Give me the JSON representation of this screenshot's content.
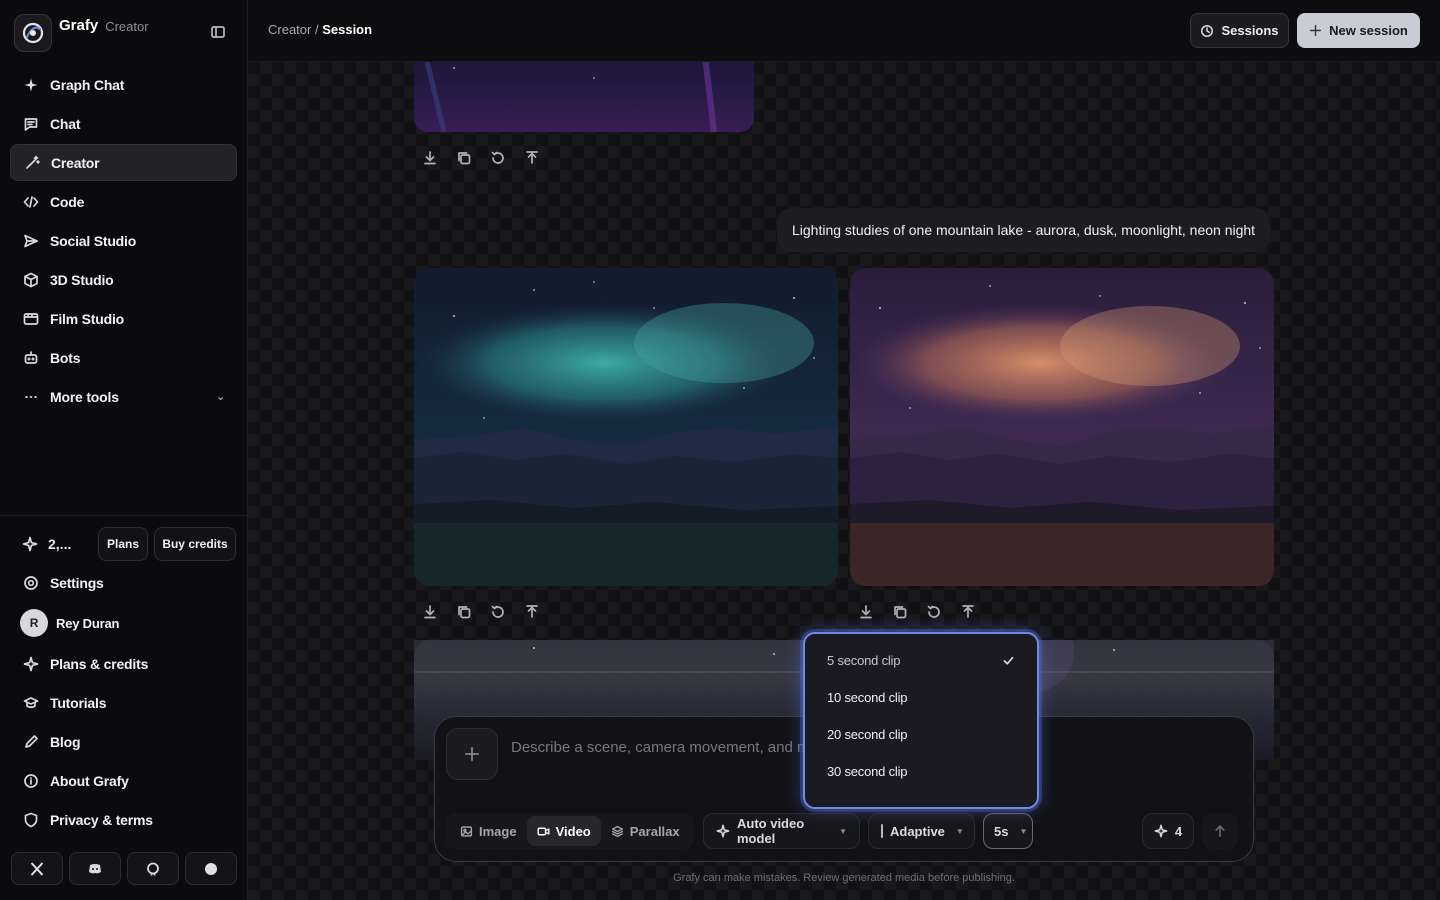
{
  "app": {
    "name": "Grafy",
    "subtitle": "Creator"
  },
  "sidebar": {
    "nav": [
      {
        "label": "Graph Chat",
        "icon": "sparkle-icon"
      },
      {
        "label": "Chat",
        "icon": "message-icon"
      },
      {
        "label": "Creator",
        "icon": "magic-wand-icon",
        "active": true
      },
      {
        "label": "Code",
        "icon": "code-icon"
      },
      {
        "label": "Social Studio",
        "icon": "send-icon"
      },
      {
        "label": "3D Studio",
        "icon": "cube-icon"
      },
      {
        "label": "Film Studio",
        "icon": "film-icon"
      },
      {
        "label": "Bots",
        "icon": "bot-icon"
      },
      {
        "label": "More tools",
        "icon": "ellipsis-icon"
      }
    ],
    "credits": {
      "value": "2,...",
      "plans_label": "Plans",
      "buy_label": "Buy credits"
    },
    "footer": [
      {
        "label": "Settings",
        "icon": "gear-icon"
      },
      {
        "label": "Plans & credits",
        "icon": "sparkle-icon"
      },
      {
        "label": "Tutorials",
        "icon": "graduation-cap-icon"
      },
      {
        "label": "Blog",
        "icon": "pen-icon"
      },
      {
        "label": "About Grafy",
        "icon": "info-icon"
      },
      {
        "label": "Privacy & terms",
        "icon": "shield-icon"
      }
    ],
    "user": {
      "initial": "R",
      "name": "Rey Duran"
    },
    "social": [
      "x-icon",
      "discord-icon",
      "github-icon",
      "circle-icon"
    ]
  },
  "topbar": {
    "breadcrumb_parent": "Creator",
    "breadcrumb_sep": " / ",
    "breadcrumb_current": "Session",
    "sessions_label": "Sessions",
    "new_session_label": "New session"
  },
  "thread": {
    "prompt": "Lighting studies of one mountain lake - aurora, dusk, moonlight, neon night",
    "action_icons": [
      "download-icon",
      "copy-icon",
      "refresh-icon",
      "share-icon"
    ]
  },
  "composer": {
    "placeholder": "Describe a scene, camera movement, and mo",
    "modes": [
      "Image",
      "Video",
      "Parallax"
    ],
    "active_mode": "Video",
    "model_label": "Auto video model",
    "adaptive_label": "Adaptive",
    "duration_label": "5s",
    "credit_cost": "4",
    "disclaimer": "Grafy can make mistakes. Review generated media before publishing."
  },
  "duration_menu": {
    "options": [
      "5 second clip",
      "10 second clip",
      "20 second clip",
      "30 second clip"
    ],
    "selected": "5 second clip"
  },
  "colors": {
    "accent_focus": "#6f8ae8",
    "aurora": "#3aa7a0",
    "dusk": "#d9875e"
  }
}
